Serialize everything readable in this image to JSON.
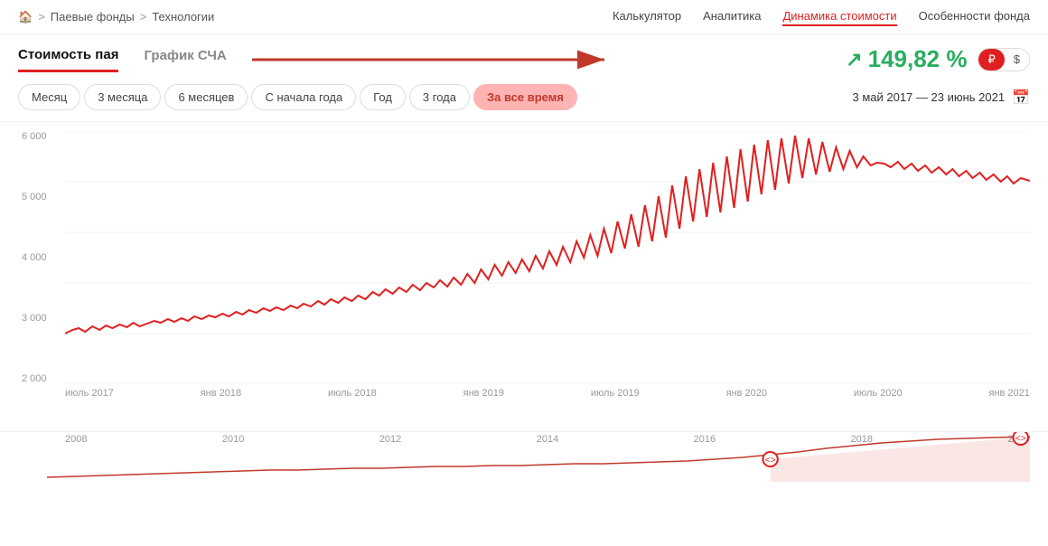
{
  "breadcrumb": {
    "home_icon": "🏠",
    "separator": ">",
    "items": [
      "Паевые фонды",
      "Технологии"
    ]
  },
  "nav": {
    "items": [
      {
        "label": "Калькулятор",
        "active": false
      },
      {
        "label": "Аналитика",
        "active": false
      },
      {
        "label": "Динамика стоимости",
        "active": true
      },
      {
        "label": "Особенности фонда",
        "active": false
      }
    ]
  },
  "tabs": [
    {
      "label": "Стоимость пая",
      "active": true
    },
    {
      "label": "График СЧА",
      "active": false
    }
  ],
  "return": {
    "value": "149,82 %",
    "currency": {
      "options": [
        "₽",
        "$"
      ],
      "active": "₽"
    }
  },
  "periods": [
    {
      "label": "Месяц",
      "active": false
    },
    {
      "label": "3 месяца",
      "active": false
    },
    {
      "label": "6 месяцев",
      "active": false
    },
    {
      "label": "С начала года",
      "active": false
    },
    {
      "label": "Год",
      "active": false
    },
    {
      "label": "3 года",
      "active": false
    },
    {
      "label": "За все время",
      "active": true
    }
  ],
  "date_range": "3 май 2017 — 23 июнь 2021",
  "chart": {
    "y_labels": [
      "6 000",
      "5 000",
      "4 000",
      "3 000",
      "2 000"
    ],
    "x_labels": [
      "июль 2017",
      "янв 2018",
      "июль 2018",
      "янв 2019",
      "июль 2019",
      "янв 2020",
      "июль 2020",
      "янв 2021"
    ]
  },
  "mini_chart": {
    "x_labels": [
      "2008",
      "2010",
      "2012",
      "2014",
      "2016",
      "2018",
      "2020"
    ]
  },
  "annotation": {
    "arrow_text": "→"
  }
}
